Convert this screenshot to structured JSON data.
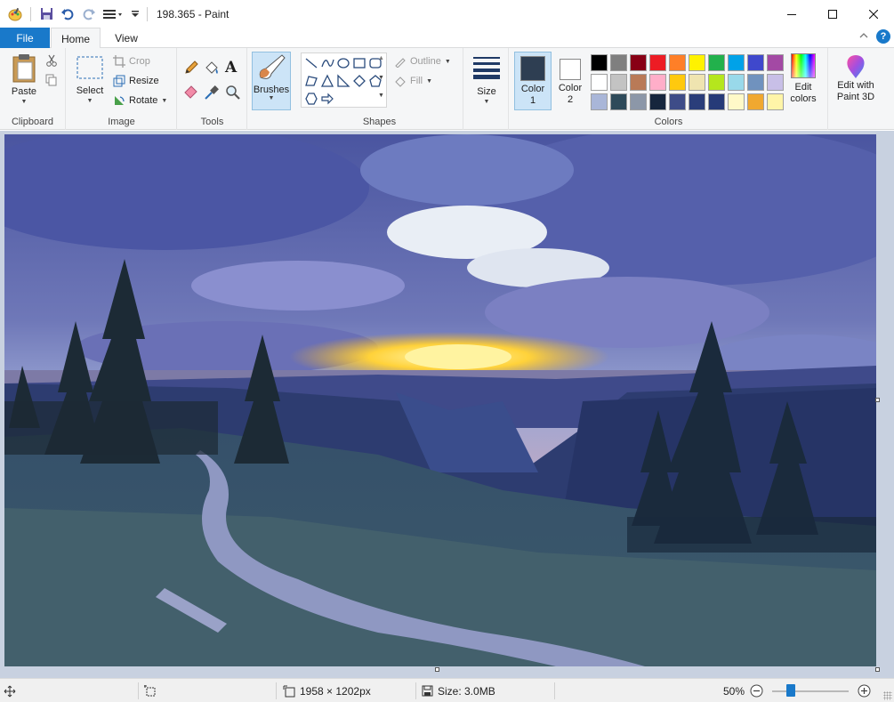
{
  "window": {
    "title": "198.365 - Paint"
  },
  "tabs": {
    "file": "File",
    "home": "Home",
    "view": "View"
  },
  "ribbon": {
    "clipboard": {
      "paste": "Paste",
      "label": "Clipboard"
    },
    "image": {
      "select": "Select",
      "crop": "Crop",
      "resize": "Resize",
      "rotate": "Rotate",
      "label": "Image"
    },
    "tools": {
      "label": "Tools"
    },
    "brushes": {
      "label": "Brushes"
    },
    "shapes": {
      "outline": "Outline",
      "fill": "Fill",
      "label": "Shapes"
    },
    "size": {
      "label": "Size"
    },
    "colors": {
      "color1_label": "Color",
      "color1_num": "1",
      "color2_label": "Color",
      "color2_num": "2",
      "color1_value": "#2e3e52",
      "color2_value": "#ffffff",
      "edit_line1": "Edit",
      "edit_line2": "colors",
      "paint3d_line1": "Edit with",
      "paint3d_line2": "Paint 3D",
      "label": "Colors",
      "palette": [
        "#000000",
        "#7f7f7f",
        "#880015",
        "#ed1c24",
        "#ff7f27",
        "#fff200",
        "#22b14c",
        "#00a2e8",
        "#3f48cc",
        "#a349a4",
        "#ffffff",
        "#c3c3c3",
        "#b97a57",
        "#ffaec9",
        "#ffc90e",
        "#efe4b0",
        "#b5e61d",
        "#99d9ea",
        "#7092be",
        "#c8bfe7",
        "#a9b6d8",
        "#2e4a5a",
        "#8c97a8",
        "#16263d",
        "#3e4c88",
        "#2a3d7a",
        "#263a78",
        "#fff9c8",
        "#f0a830",
        "#fff5a8"
      ]
    }
  },
  "status": {
    "dimensions": "1958 × 1202px",
    "size": "Size: 3.0MB",
    "zoom": "50%"
  }
}
